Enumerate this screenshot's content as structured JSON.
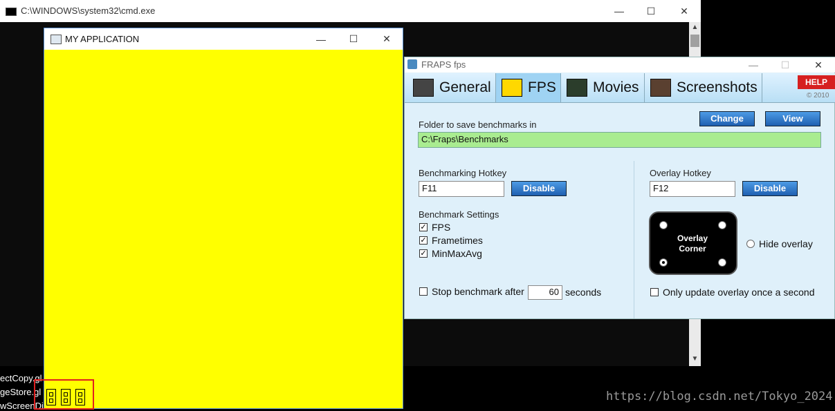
{
  "cmd": {
    "title": "C:\\WINDOWS\\system32\\cmd.exe",
    "minimize": "—",
    "maximize": "☐",
    "close": "✕",
    "bottom_text": [
      "ectCopy.gl",
      "geStore.gl",
      "wScreenDi"
    ]
  },
  "app": {
    "title": "MY APPLICATION",
    "minimize": "—",
    "maximize": "☐",
    "close": "✕",
    "background": "#ffff00"
  },
  "fraps": {
    "title": "FRAPS fps",
    "minimize": "—",
    "maximize": "☐",
    "close": "✕",
    "tabs": [
      {
        "label": "General",
        "icon": "grid-icon"
      },
      {
        "label": "FPS",
        "icon": "fps-99-icon",
        "active": true
      },
      {
        "label": "Movies",
        "icon": "film-icon"
      },
      {
        "label": "Screenshots",
        "icon": "camera-icon"
      }
    ],
    "help": "HELP",
    "copyright": "© 2010",
    "folder": {
      "label": "Folder to save benchmarks in",
      "value": "C:\\Fraps\\Benchmarks",
      "change": "Change",
      "view": "View"
    },
    "benchmark_hotkey": {
      "label": "Benchmarking Hotkey",
      "value": "F11",
      "disable": "Disable"
    },
    "overlay_hotkey": {
      "label": "Overlay Hotkey",
      "value": "F12",
      "disable": "Disable"
    },
    "benchmark_settings": {
      "label": "Benchmark Settings",
      "fps": "FPS",
      "frametimes": "Frametimes",
      "minmaxavg": "MinMaxAvg"
    },
    "stop_benchmark": {
      "label": "Stop benchmark after",
      "value": "60",
      "unit": "seconds"
    },
    "overlay_corner": "Overlay Corner",
    "hide_overlay": "Hide overlay",
    "only_update": "Only update overlay once a second",
    "check_mark": "✓"
  },
  "watermark": "https://blog.csdn.net/Tokyo_2024"
}
